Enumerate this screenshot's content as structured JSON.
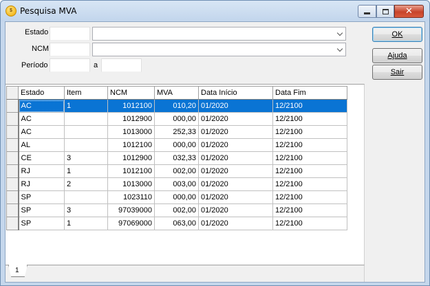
{
  "window": {
    "title": "Pesquisa MVA",
    "icon": "app-coin-icon"
  },
  "filters": {
    "estado_label": "Estado",
    "ncm_label": "NCM",
    "periodo_label": "Período",
    "periodo_sep": "a",
    "estado_code": "",
    "estado_name": "",
    "ncm_code": "",
    "ncm_name": "",
    "periodo_from": "",
    "periodo_to": ""
  },
  "buttons": {
    "ok": "OK",
    "ajuda": "Ajuda",
    "sair": "Sair"
  },
  "grid": {
    "columns": [
      "Estado",
      "Item",
      "NCM",
      "MVA",
      "Data Início",
      "Data Fim"
    ],
    "rows": [
      [
        "AC",
        "1",
        "1012100",
        "010,20",
        "01/2020",
        "12/2100"
      ],
      [
        "AC",
        "",
        "1012900",
        "000,00",
        "01/2020",
        "12/2100"
      ],
      [
        "AC",
        "",
        "1013000",
        "252,33",
        "01/2020",
        "12/2100"
      ],
      [
        "AL",
        "",
        "1012100",
        "000,00",
        "01/2020",
        "12/2100"
      ],
      [
        "CE",
        "3",
        "1012900",
        "032,33",
        "01/2020",
        "12/2100"
      ],
      [
        "RJ",
        "1",
        "1012100",
        "002,00",
        "01/2020",
        "12/2100"
      ],
      [
        "RJ",
        "2",
        "1013000",
        "003,00",
        "01/2020",
        "12/2100"
      ],
      [
        "SP",
        "",
        "1023110",
        "000,00",
        "01/2020",
        "12/2100"
      ],
      [
        "SP",
        "3",
        "97039000",
        "002,00",
        "01/2020",
        "12/2100"
      ],
      [
        "SP",
        "1",
        "97069000",
        "063,00",
        "01/2020",
        "12/2100"
      ]
    ],
    "selected_row": 0
  },
  "tabs": [
    "1"
  ],
  "colors": {
    "selection": "#0a74d4",
    "titlebar": "#c5d7ec",
    "close_button": "#c7432a"
  }
}
